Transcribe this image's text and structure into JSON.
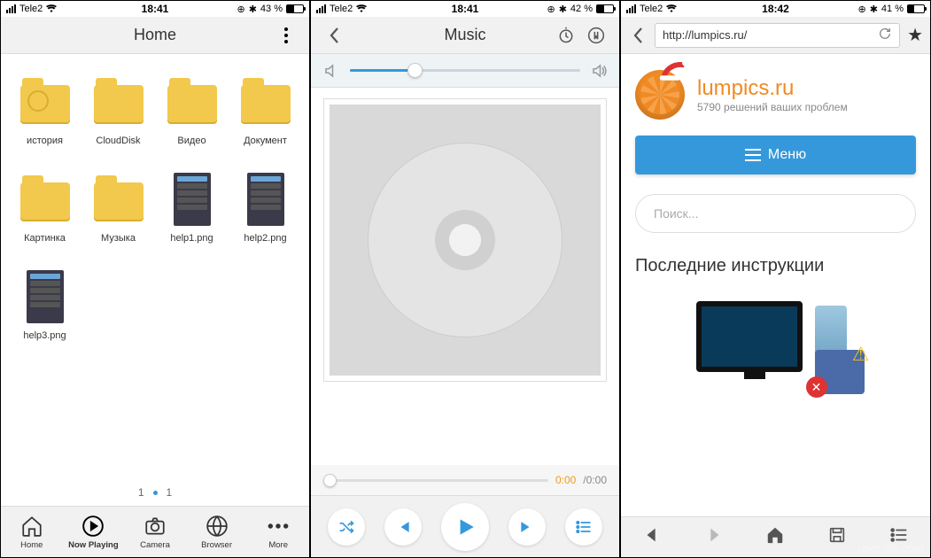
{
  "screen1": {
    "status": {
      "carrier": "Tele2",
      "time": "18:41",
      "battery_text": "43 %",
      "battery_pct": 43
    },
    "nav_title": "Home",
    "items": [
      {
        "type": "folder-clock",
        "label": "история"
      },
      {
        "type": "folder",
        "label": "CloudDisk"
      },
      {
        "type": "folder",
        "label": "Видео"
      },
      {
        "type": "folder",
        "label": "Документ"
      },
      {
        "type": "folder",
        "label": "Картинка"
      },
      {
        "type": "folder",
        "label": "Музыка"
      },
      {
        "type": "image",
        "label": "help1.png"
      },
      {
        "type": "image",
        "label": "help2.png"
      },
      {
        "type": "image",
        "label": "help3.png"
      }
    ],
    "pager": {
      "current": "1",
      "total": "1"
    },
    "tabs": [
      {
        "name": "Home"
      },
      {
        "name": "Now Playing",
        "active": true
      },
      {
        "name": "Camera"
      },
      {
        "name": "Browser"
      },
      {
        "name": "More"
      }
    ]
  },
  "screen2": {
    "status": {
      "carrier": "Tele2",
      "time": "18:41",
      "battery_text": "42 %",
      "battery_pct": 42
    },
    "nav_title": "Music",
    "volume_pct": 28,
    "time_current": "0:00",
    "time_total": "/0:00"
  },
  "screen3": {
    "status": {
      "carrier": "Tele2",
      "time": "18:42",
      "battery_text": "41 %",
      "battery_pct": 41
    },
    "url": "http://lumpics.ru/",
    "brand_name": "lumpics.ru",
    "brand_sub": "5790 решений ваших проблем",
    "menu_label": "Меню",
    "search_placeholder": "Поиск...",
    "section_heading": "Последние инструкции"
  },
  "watermark": "user-life.com"
}
